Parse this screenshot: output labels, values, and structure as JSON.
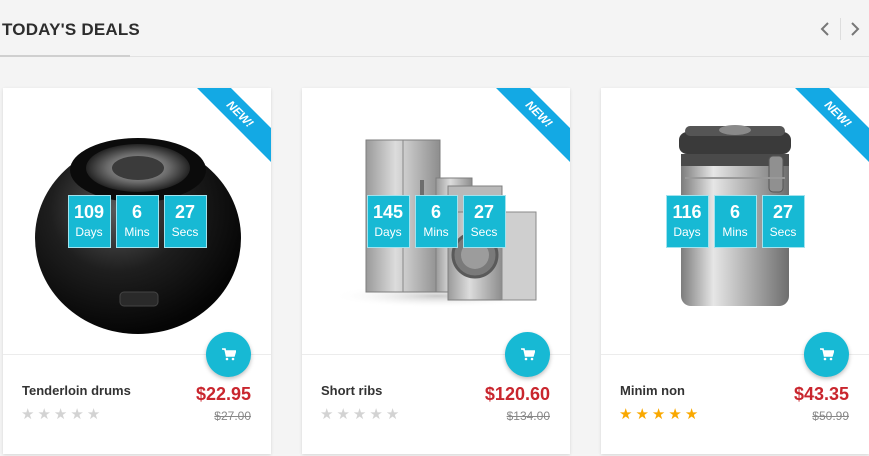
{
  "header": {
    "title": "TODAY'S DEALS"
  },
  "nav": {
    "prev_icon": "chevron-left-icon",
    "next_icon": "chevron-right-icon"
  },
  "products": [
    {
      "badge": "NEW!",
      "name": "Tenderloin drums",
      "price": "$22.95",
      "old_price": "$27.00",
      "countdown": {
        "days": "109",
        "days_label": "Days",
        "mins": "6",
        "mins_label": "Mins",
        "secs": "27",
        "secs_label": "Secs"
      },
      "rating": 0,
      "image": "speaker-image"
    },
    {
      "badge": "NEW!",
      "name": "Short ribs",
      "price": "$120.60",
      "old_price": "$134.00",
      "countdown": {
        "days": "145",
        "days_label": "Days",
        "mins": "6",
        "mins_label": "Mins",
        "secs": "27",
        "secs_label": "Secs"
      },
      "rating": 0,
      "image": "appliances-image"
    },
    {
      "badge": "NEW!",
      "name": "Minim non",
      "price": "$43.35",
      "old_price": "$50.99",
      "countdown": {
        "days": "116",
        "days_label": "Days",
        "mins": "6",
        "mins_label": "Mins",
        "secs": "27",
        "secs_label": "Secs"
      },
      "rating": 5,
      "image": "canister-image"
    }
  ],
  "colors": {
    "accent": "#17b9d4",
    "ribbon": "#13a9e4",
    "price": "#c9262e",
    "star_on": "#f9a800",
    "star_off": "#d3d3d3"
  }
}
